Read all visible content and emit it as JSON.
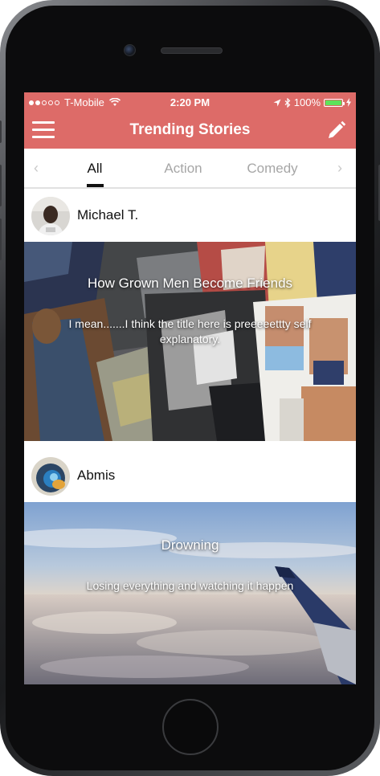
{
  "status_bar": {
    "carrier": "T-Mobile",
    "time": "2:20 PM",
    "battery": "100%"
  },
  "nav": {
    "title": "Trending Stories",
    "menu_icon": "hamburger-menu-icon",
    "edit_icon": "pencil-icon"
  },
  "tabs": [
    {
      "label": "All",
      "active": true
    },
    {
      "label": "Action",
      "active": false
    },
    {
      "label": "Comedy",
      "active": false
    }
  ],
  "stories": [
    {
      "author": "Michael T.",
      "title": "How Grown Men Become Friends",
      "description": "I mean.......I think the title here is preeeeettty self explanatory."
    },
    {
      "author": "Abmis",
      "title": "Drowning",
      "description": "Losing everything and watching it happen"
    }
  ],
  "colors": {
    "header": "#dd6b68",
    "battery": "#5ee35a"
  }
}
